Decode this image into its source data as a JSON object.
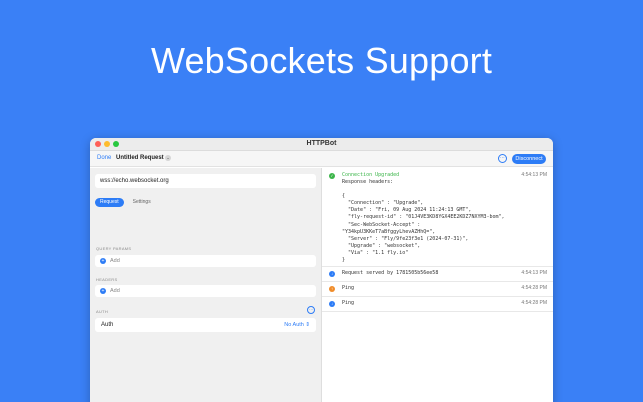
{
  "headline": "WebSockets Support",
  "window": {
    "title": "HTTPBot",
    "toolbar": {
      "done_label": "Done",
      "request_title": "Untitled Request",
      "chevron_glyph": "⌄",
      "more_glyph": "⋯",
      "disconnect_label": "Disconnect"
    }
  },
  "request": {
    "url": "wss://echo.websocket.org",
    "tabs": [
      {
        "label": "Request",
        "active": true
      },
      {
        "label": "Settings",
        "active": false
      }
    ],
    "query_params": {
      "label": "QUERY PARAMS",
      "add_label": "Add"
    },
    "headers": {
      "label": "HEADERS",
      "add_label": "Add"
    },
    "auth": {
      "label": "AUTH",
      "row_label": "Auth",
      "value": "No Auth ⇕",
      "more_glyph": "⋯"
    },
    "add_glyph": "+"
  },
  "log": [
    {
      "status": "green",
      "icon": "check-icon",
      "glyph": "✓",
      "title": "Connection Upgraded",
      "body": "Response headers:\n\n{\n  \"Connection\" : \"Upgrade\",\n  \"Date\" : \"Fri, 09 Aug 2024 11:24:13 GMT\",\n  \"fly-request-id\" : \"01J4VE3KD8YGX4EE2KDZ7NXYM3-bom\",\n  \"Sec-WebSocket-Accept\" :\n\"Y34kpU3KKeT7aBfggyLhevAZHhQ=\",\n  \"Server\" : \"Fly/9fe23f3e1 (2024-07-31)\",\n  \"Upgrade\" : \"websocket\",\n  \"Via\" : \"1.1 fly.io\"\n}",
      "time": "4:54:13 PM"
    },
    {
      "status": "blue",
      "icon": "arrow-down-icon",
      "glyph": "↓",
      "title": "Request served by 1781505b56ee58",
      "time": "4:54:13 PM"
    },
    {
      "status": "orange",
      "icon": "arrow-up-icon",
      "glyph": "↑",
      "title": "Ping",
      "time": "4:54:28 PM"
    },
    {
      "status": "blue",
      "icon": "arrow-down-icon",
      "glyph": "↓",
      "title": "Ping",
      "time": "4:54:28 PM"
    }
  ],
  "colors": {
    "background": "#3a80f6",
    "accent": "#2d7cf6",
    "success": "#3cb54a",
    "warning": "#f08c2a"
  }
}
